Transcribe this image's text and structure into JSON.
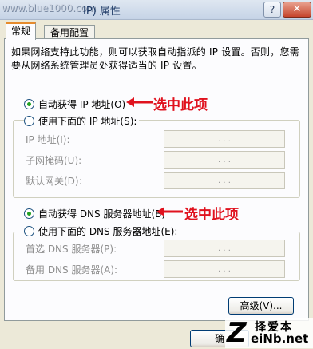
{
  "titlebar": {
    "watermark": "www.blue1000.com",
    "title": "IP) 属性",
    "help_label": "?",
    "close_label": "✕"
  },
  "tabs": [
    {
      "label": "常规",
      "active": true
    },
    {
      "label": "备用配置",
      "active": false
    }
  ],
  "intro": "如果网络支持此功能，则可以获取自动指派的 IP 设置。否则，您需要从网络系统管理员处获得适当的 IP 设置。",
  "ip_section": {
    "auto_label": "自动获得 IP 地址(O)",
    "auto_checked": true,
    "manual_label": "使用下面的 IP 地址(S):",
    "manual_checked": false,
    "fields": [
      {
        "label": "IP 地址(I):",
        "value": ". . ."
      },
      {
        "label": "子网掩码(U):",
        "value": ". . ."
      },
      {
        "label": "默认网关(D):",
        "value": ". . ."
      }
    ]
  },
  "dns_section": {
    "auto_label": "自动获得 DNS 服务器地址(B)",
    "auto_checked": true,
    "manual_label": "使用下面的 DNS 服务器地址(E):",
    "manual_checked": false,
    "fields": [
      {
        "label": "首选 DNS 服务器(P):",
        "value": ". . ."
      },
      {
        "label": "备用 DNS 服务器(A):",
        "value": ". . ."
      }
    ]
  },
  "annotations": {
    "first": "选中此项",
    "second": "选中此项",
    "color": "#e0121e"
  },
  "buttons": {
    "advanced": "高级(V)...",
    "ok": "确"
  },
  "logo": {
    "letter": "Z",
    "cn_text": "择爱本",
    "en_text": "eiNb.net"
  }
}
